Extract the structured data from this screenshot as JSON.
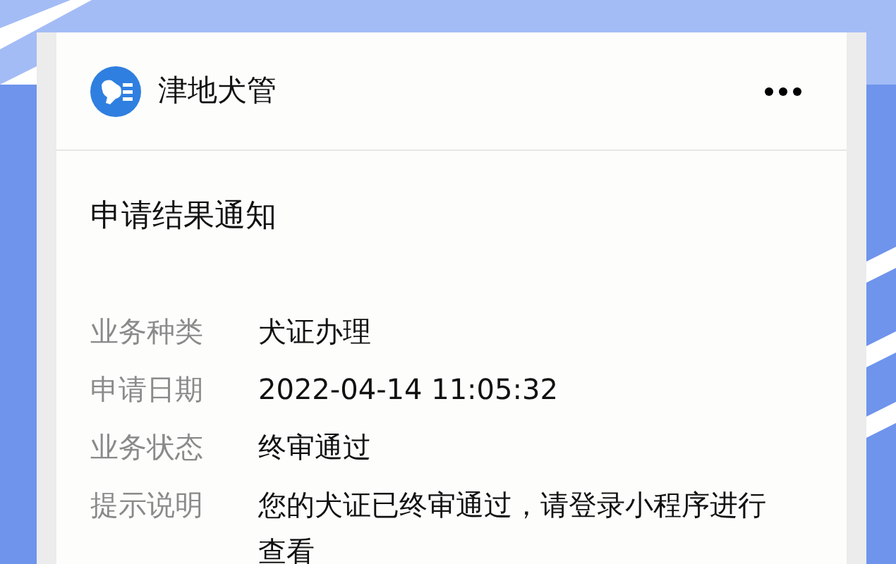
{
  "app": {
    "name": "津地犬管"
  },
  "notification": {
    "title": "申请结果通知",
    "fields": [
      {
        "label": "业务种类",
        "value": "犬证办理"
      },
      {
        "label": "申请日期",
        "value": "2022-04-14 11:05:32"
      },
      {
        "label": "业务状态",
        "value": "终审通过"
      },
      {
        "label": "提示说明",
        "value": "您的犬证已终审通过，请登录小程序进行查看"
      }
    ]
  }
}
